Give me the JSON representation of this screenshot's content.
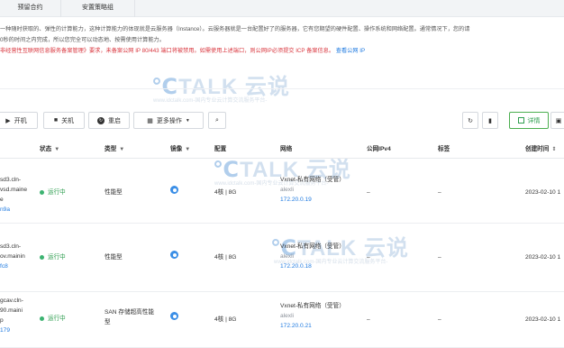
{
  "tabs": [
    "预留合约",
    "安置策略组"
  ],
  "description": {
    "line1": "一种随时获取的、弹性的计算能力，这种计算能力的体现就是云服务器（Instance）。云服务器就是一台配置好了的服务器，它有您期望的硬件配置、操作系统和网络配置。通常情况下，您的请",
    "line2": "0秒的时间之内完成，所以您完全可以动态地、按需使用计算能力。",
    "line3_warn": "非经营性互联网信息服务备案管理》要求，未备案公网 IP 80/443 端口将被禁用。如需使用上述端口，则公网IP必须提交 ICP 备案信息。",
    "line3_link": "查看公网 IP"
  },
  "watermark": {
    "brand": "TALK 云说",
    "site": "www.idctalk.com-国内专业云计算交流服务平台-"
  },
  "toolbar": {
    "start": "开机",
    "stop": "关机",
    "restart": "重启",
    "more": "更多操作",
    "detail": "详情",
    "icons": {
      "start": "play-icon",
      "stop": "stop-icon",
      "restart": "restart-icon",
      "more": "more-icon",
      "search": "search-icon",
      "refresh": "refresh-icon",
      "columns": "columns-icon",
      "detail": "grid-icon"
    }
  },
  "table": {
    "headers": {
      "status": "状态",
      "type": "类型",
      "image": "镜像",
      "config": "配置",
      "network": "网络",
      "public_ip": "公网IPv4",
      "tags": "标签",
      "created": "创建时间"
    },
    "rows": [
      {
        "id_line1": "sd3.cln-",
        "id_line2": "vsd.maine",
        "id_line3": "e",
        "id_link": "n9a",
        "status": "运行中",
        "type": "性能型",
        "config": "4核 | 8G",
        "network": "Vxnet-私有网络（受管）",
        "net_user": "alexli",
        "ip": "172.20.0.19",
        "public_ip": "–",
        "tags": "–",
        "created": "2023-02-10 1"
      },
      {
        "id_line1": "sd3.cln-",
        "id_line2": "ov.mainin",
        "id_line3": "",
        "id_link": "fc8",
        "status": "运行中",
        "type": "性能型",
        "config": "4核 | 8G",
        "network": "Vxnet-私有网络（受管）",
        "net_user": "alexli",
        "ip": "172.20.0.18",
        "public_ip": "–",
        "tags": "–",
        "created": "2023-02-10 1"
      },
      {
        "id_line1": "gcav.cln-",
        "id_line2": "90.maini",
        "id_line3": "p",
        "id_link": "179",
        "status": "运行中",
        "type": "SAN 存储超高性能型",
        "type_line1": "SAN 存储超高性能",
        "type_line2": "型",
        "config": "4核 | 8G",
        "network": "Vxnet-私有网络（受管）",
        "net_user": "alexli",
        "ip": "172.20.0.21",
        "public_ip": "–",
        "tags": "–",
        "created": "2023-02-10 1"
      }
    ]
  },
  "colors": {
    "accent": "#1f7ae0",
    "running": "#2e9e4f",
    "warning": "#d9363e"
  }
}
